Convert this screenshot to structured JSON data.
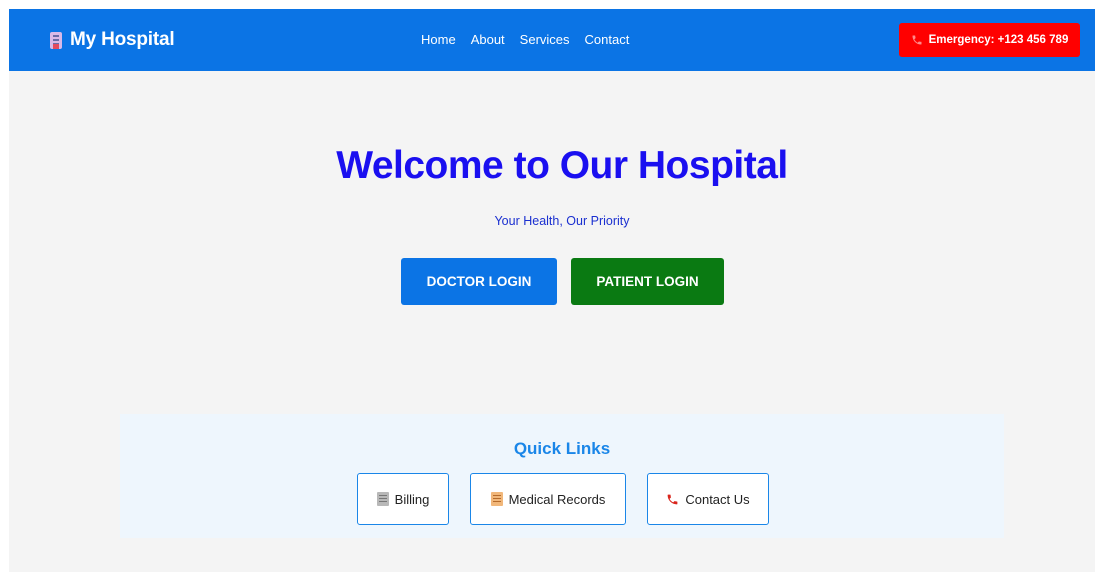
{
  "navbar": {
    "brand": "My Hospital",
    "brand_icon": "hospital-icon",
    "links": [
      "Home",
      "About",
      "Services",
      "Contact"
    ],
    "emergency_label": "Emergency: +123 456 789",
    "emergency_icon": "phone-icon"
  },
  "hero": {
    "title": "Welcome to Our Hospital",
    "subtitle": "Your Health, Our Priority",
    "doctor_login": "DOCTOR LOGIN",
    "patient_login": "PATIENT LOGIN"
  },
  "quick_links": {
    "title": "Quick Links",
    "items": [
      {
        "label": "Billing",
        "icon": "billing-icon"
      },
      {
        "label": "Medical Records",
        "icon": "medical-records-icon"
      },
      {
        "label": "Contact Us",
        "icon": "phone-icon"
      }
    ]
  },
  "colors": {
    "primary": "#0b74e5",
    "emergency": "#ff0000",
    "patient_button": "#0a7a12",
    "hero_title": "#1a0ff0",
    "quick_links_bg": "#eef6fd"
  }
}
